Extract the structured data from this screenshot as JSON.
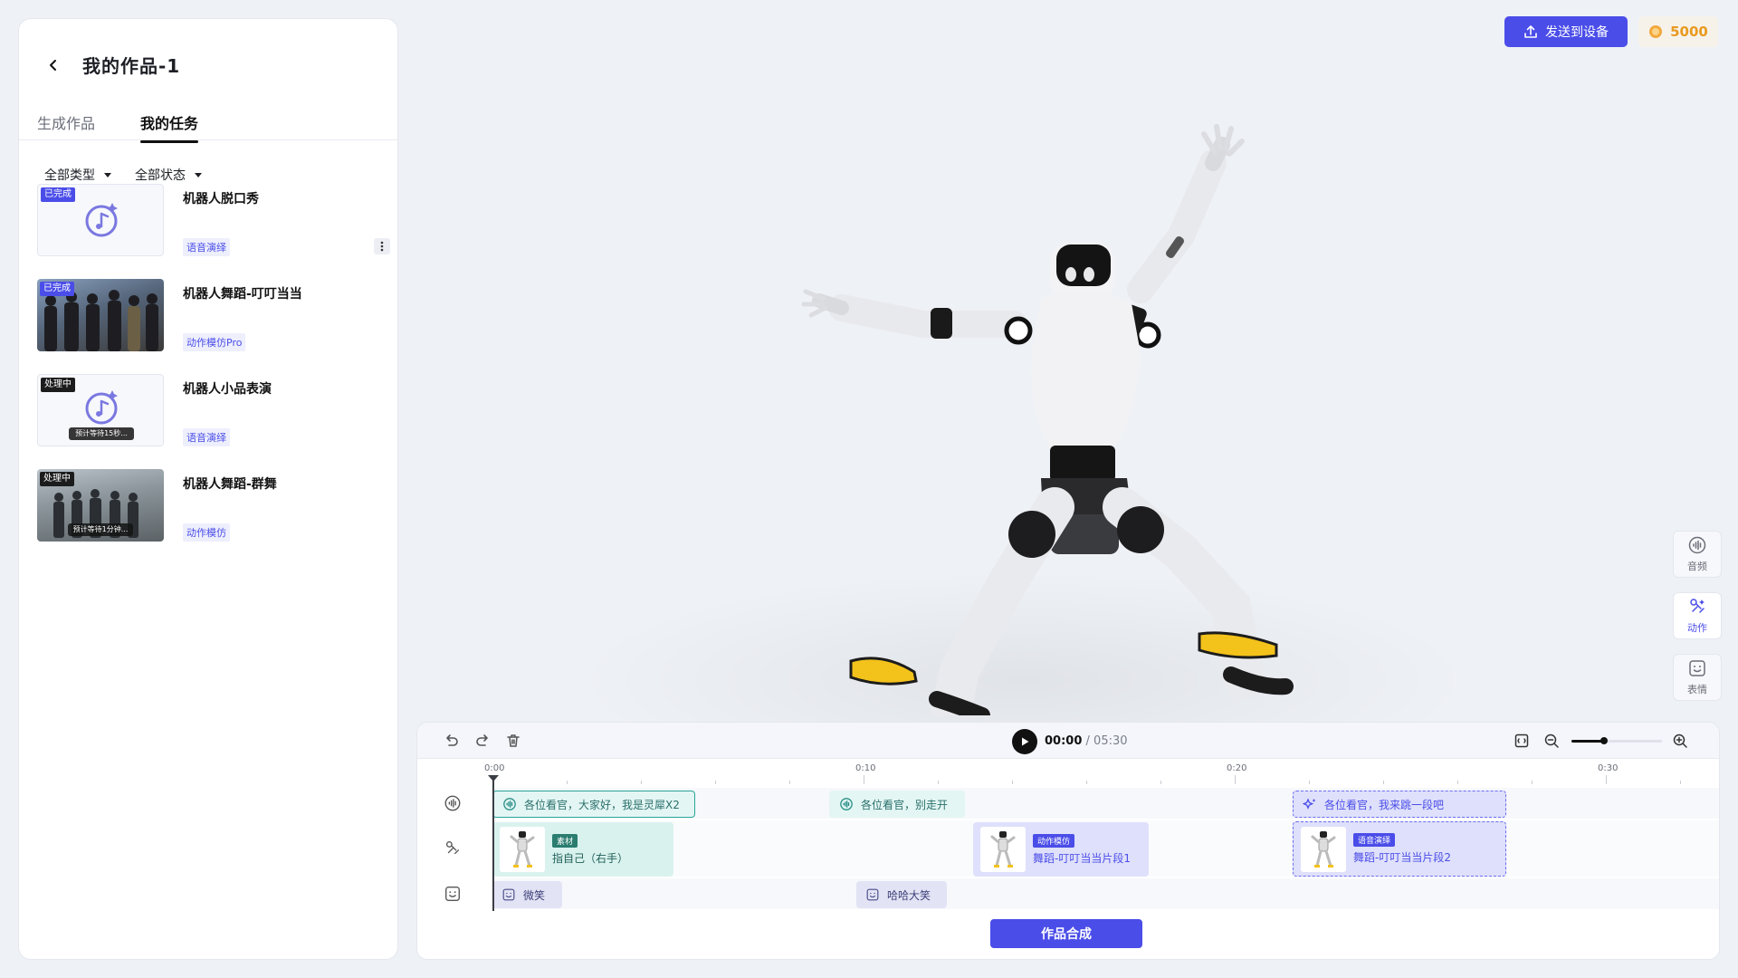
{
  "panel": {
    "title": "我的作品-1",
    "tabs": [
      {
        "label": "生成作品",
        "active": false
      },
      {
        "label": "我的任务",
        "active": true
      }
    ],
    "filters": {
      "type": "全部类型",
      "status": "全部状态"
    }
  },
  "tasks": [
    {
      "title": "机器人脱口秀",
      "status": "已完成",
      "tag": "语音演绎",
      "thumb": "music-icon"
    },
    {
      "title": "机器人舞蹈-叮叮当当",
      "status": "已完成",
      "tag": "动作模仿Pro",
      "thumb": "photo"
    },
    {
      "title": "机器人小品表演",
      "status": "处理中",
      "tag": "语音演绎",
      "thumb": "music-icon",
      "wait": "预计等待15秒..."
    },
    {
      "title": "机器人舞蹈-群舞",
      "status": "处理中",
      "tag": "动作模仿",
      "thumb": "photo",
      "wait": "预计等待1分钟..."
    }
  ],
  "header": {
    "send_label": "发送到设备",
    "coins": "5000"
  },
  "tools": [
    {
      "label": "音频",
      "icon": "audio-icon",
      "active": false
    },
    {
      "label": "动作",
      "icon": "motion-icon",
      "active": true
    },
    {
      "label": "表情",
      "icon": "emotion-icon",
      "active": false
    }
  ],
  "timeline": {
    "current": "00:00",
    "total": "/ 05:30",
    "zoom_level": 0.36,
    "ruler": [
      "0:00",
      "0:10",
      "0:20",
      "0:30"
    ],
    "audio_clips": [
      {
        "text": "各位看官，大家好，我是灵犀X2"
      },
      {
        "text": "各位看官，别走开"
      },
      {
        "text": "各位看官，我来跳一段吧"
      }
    ],
    "motion_clips": [
      {
        "tag": "素材",
        "name": "指自己（右手）"
      },
      {
        "tag": "动作模仿",
        "name": "舞蹈-叮叮当当片段1"
      },
      {
        "tag": "语音演绎",
        "name": "舞蹈-叮叮当当片段2"
      }
    ],
    "face_clips": [
      {
        "text": "微笑"
      },
      {
        "text": "哈哈大笑"
      }
    ],
    "compose_label": "作品合成"
  },
  "colors": {
    "accent": "#4a4de8",
    "coin": "#e99a1f",
    "teal": "#2aa59a"
  }
}
